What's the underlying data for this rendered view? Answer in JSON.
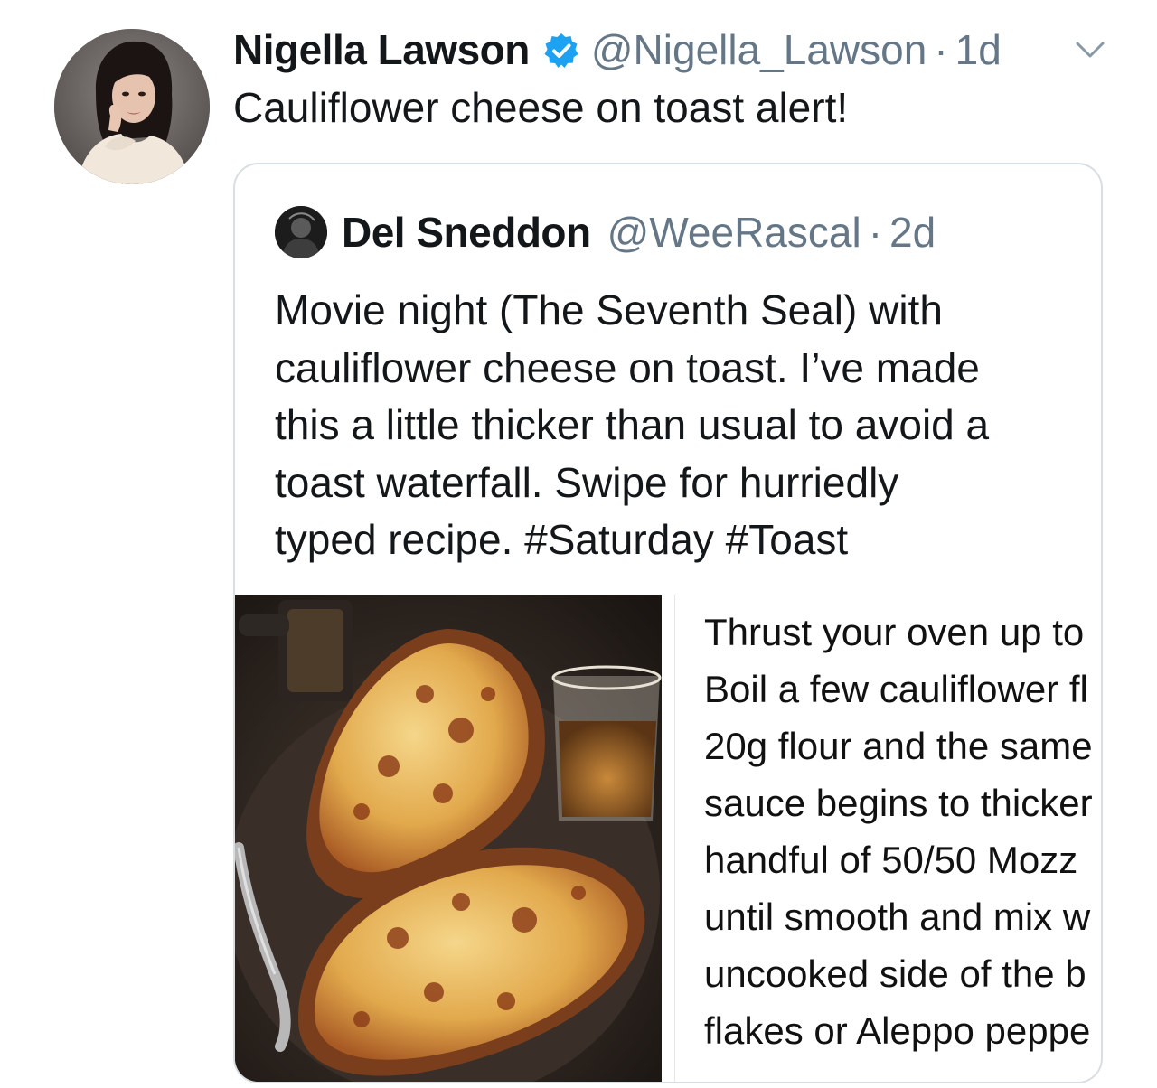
{
  "tweet": {
    "author": {
      "display_name": "Nigella Lawson",
      "handle": "@Nigella_Lawson",
      "verified": true,
      "avatar_icon": "profile-photo"
    },
    "separator": "·",
    "time": "1d",
    "text": "Cauliflower cheese on toast alert!",
    "menu_icon": "chevron-down-icon",
    "quoted": {
      "author": {
        "display_name": "Del Sneddon",
        "handle": "@WeeRascal",
        "avatar_icon": "profile-photo"
      },
      "separator": "·",
      "time": "2d",
      "text_lines": [
        "Movie night (The Seventh Seal) with",
        "cauliflower cheese on toast. I’ve made",
        "this a little thicker than usual to avoid a",
        "toast waterfall. Swipe for hurriedly",
        "typed recipe. "
      ],
      "hashtags": [
        "#Saturday",
        "#Toast"
      ],
      "media": {
        "photo_subject": "cauliflower cheese on toast with glass of whisky",
        "recipe_lines": [
          "Thrust your oven up to",
          "Boil a few cauliflower fl",
          "20g flour and the same",
          "sauce begins to thicker",
          "handful of 50/50 Mozz",
          "until smooth and mix w",
          "uncooked side of the b",
          "flakes or Aleppo peppe"
        ]
      }
    }
  },
  "colors": {
    "text_primary": "#14171a",
    "text_secondary": "#657786",
    "verified_blue": "#1da1f2",
    "card_border": "#d9dee3"
  }
}
